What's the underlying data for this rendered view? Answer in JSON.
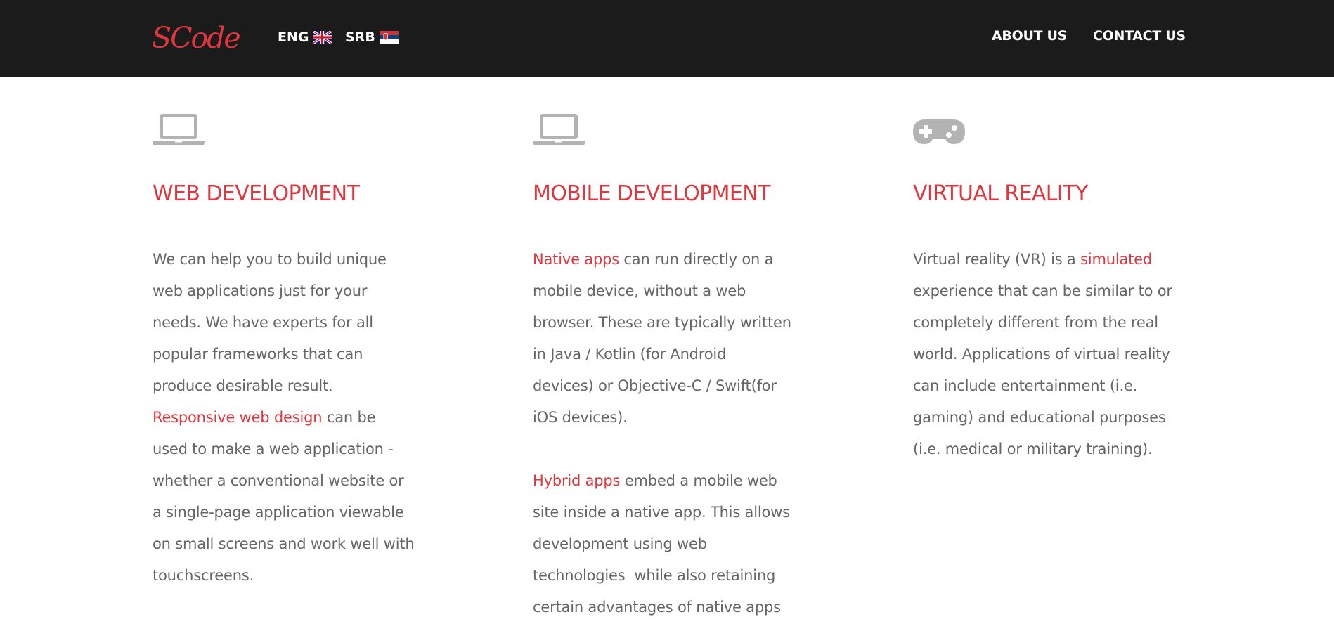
{
  "header": {
    "logo": "SCode",
    "languages": [
      {
        "code": "ENG",
        "flag_icon": "uk-flag-icon"
      },
      {
        "code": "SRB",
        "flag_icon": "serbia-flag-icon"
      }
    ],
    "nav": {
      "about": "ABOUT US",
      "contact": "CONTACT US"
    }
  },
  "colors": {
    "accent": "#e0373f",
    "header_bg": "#1b1b1b",
    "text": "#666666",
    "icon": "#b3b3b3"
  },
  "columns": {
    "web": {
      "icon": "laptop-icon",
      "title": "WEB DEVELOPMENT",
      "p1_lines": [
        "We can help you to build unique",
        "web applications just for your",
        "needs. We have experts for all",
        "popular frameworks that can",
        "produce desirable result."
      ],
      "p2_highlight": "Responsive web design",
      "p2_first_rest": " can be",
      "p2_lines": [
        "used to make a web application -",
        "whether a conventional website or",
        "a single-page application viewable",
        "on small screens and work well with",
        "touchscreens."
      ]
    },
    "mobile": {
      "icon": "laptop-icon",
      "title": "MOBILE DEVELOPMENT",
      "p1_highlight": "Native apps",
      "p1_first_rest": " can run directly on a",
      "p1_lines": [
        "mobile device, without a web",
        "browser. These are typically written",
        "in Java / Kotlin (for Android",
        "devices) or Objective-C / Swift(for",
        "iOS devices)."
      ],
      "p2_highlight": "Hybrid apps",
      "p2_first_rest": " embed a mobile web",
      "p2_lines": [
        "site inside a native app. This allows",
        "development using web",
        "technologies  while also retaining",
        "certain advantages of native apps"
      ]
    },
    "vr": {
      "icon": "gamepad-icon",
      "title": "VIRTUAL REALITY",
      "p1_first": "Virtual reality (VR) is a ",
      "p1_highlight": "simulated",
      "p1_lines": [
        "experience that can be similar to or",
        "completely different from the real",
        "world. Applications of virtual reality",
        "can include entertainment (i.e.",
        "gaming) and educational purposes",
        "(i.e. medical or military training)."
      ]
    }
  }
}
